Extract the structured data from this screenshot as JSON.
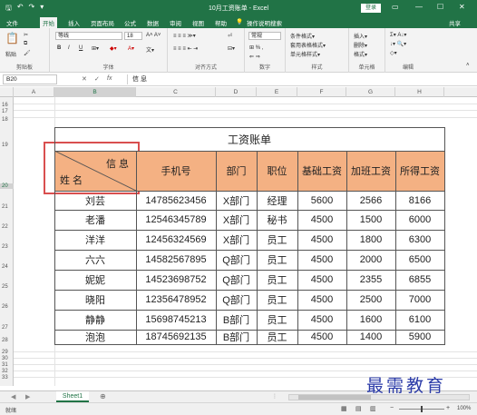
{
  "window": {
    "title": "10月工资账单 - Excel",
    "login": "登录",
    "qat": [
      "🖫",
      "↶",
      "↷",
      "▾"
    ],
    "controls": [
      "▭",
      "—",
      "☐",
      "✕"
    ]
  },
  "tabs": [
    "文件",
    "开始",
    "插入",
    "页面布局",
    "公式",
    "数据",
    "审阅",
    "视图",
    "帮助",
    "💡",
    "操作说明搜索"
  ],
  "active_tab_index": 1,
  "share": "共享",
  "ribbon": {
    "clipboard": {
      "paste": "粘贴",
      "label": "剪贴板"
    },
    "font": {
      "name": "等线",
      "size": "18",
      "label": "字体",
      "bold": "B",
      "italic": "I",
      "underline": "U"
    },
    "alignment": {
      "label": "对齐方式"
    },
    "number": {
      "format": "常规",
      "label": "数字"
    },
    "styles": {
      "items": [
        "条件格式▾",
        "套用表格格式▾",
        "单元格样式▾"
      ],
      "label": "样式"
    },
    "cells": {
      "items": [
        "插入▾",
        "删除▾",
        "格式▾"
      ],
      "label": "单元格"
    },
    "editing": {
      "label": "编辑"
    }
  },
  "formula_bar": {
    "name_box": "B20",
    "fx": "fx",
    "value": "信 息"
  },
  "columns": [
    "A",
    "B",
    "C",
    "D",
    "E",
    "F",
    "G",
    "H"
  ],
  "rows_top": [
    "16",
    "17",
    "18"
  ],
  "rows_bottom": [
    "29",
    "30",
    "31",
    "32",
    "33",
    "34",
    "35",
    "36",
    "37"
  ],
  "table": {
    "title": "工资账单",
    "diag_top": "信 息",
    "diag_bottom": "姓 名",
    "headers": [
      "手机号",
      "部门",
      "职位",
      "基础工资",
      "加班工资",
      "所得工资"
    ],
    "rows": [
      {
        "n": "21",
        "c": [
          "刘芸",
          "14785623456",
          "X部门",
          "经理",
          "5600",
          "2566",
          "8166"
        ]
      },
      {
        "n": "22",
        "c": [
          "老潘",
          "12546345789",
          "X部门",
          "秘书",
          "4500",
          "1500",
          "6000"
        ]
      },
      {
        "n": "23",
        "c": [
          "洋洋",
          "12456324569",
          "X部门",
          "员工",
          "4500",
          "1800",
          "6300"
        ]
      },
      {
        "n": "24",
        "c": [
          "六六",
          "14582567895",
          "Q部门",
          "员工",
          "4500",
          "2000",
          "6500"
        ]
      },
      {
        "n": "25",
        "c": [
          "妮妮",
          "14523698752",
          "Q部门",
          "员工",
          "4500",
          "2355",
          "6855"
        ]
      },
      {
        "n": "26",
        "c": [
          "晓阳",
          "12356478952",
          "Q部门",
          "员工",
          "4500",
          "2500",
          "7000"
        ]
      },
      {
        "n": "27",
        "c": [
          "静静",
          "15698745213",
          "B部门",
          "员工",
          "4500",
          "1600",
          "6100"
        ]
      },
      {
        "n": "28",
        "c": [
          "泡泡",
          "18745692135",
          "B部门",
          "员工",
          "4500",
          "1400",
          "5900"
        ]
      }
    ],
    "header_color": "#f4b183"
  },
  "sheet_tab": "Sheet1",
  "status": {
    "left": "就绪",
    "zoom": "100%"
  },
  "watermark": "最需教育",
  "accent": "#217346"
}
